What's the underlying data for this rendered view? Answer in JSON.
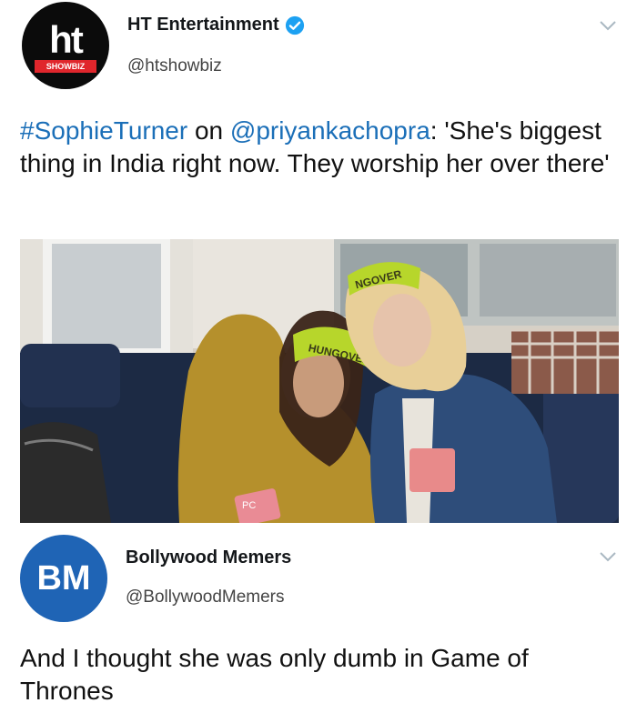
{
  "tweet1": {
    "avatar_text": "ht",
    "avatar_sub": "SHOWBIZ",
    "name": "HT Entertainment",
    "handle": "@htshowbiz",
    "text_parts": [
      "#SophieTurner",
      " on ",
      "@priyankachopra",
      ": 'She's biggest thing in India right now. They worship her over there'"
    ],
    "image": {
      "mask_text_left": "HUNGOVER",
      "mask_text_right": "NGOVER",
      "flask_text": "PC"
    }
  },
  "tweet2": {
    "avatar_text": "BM",
    "name": "Bollywood Memers",
    "handle": "@BollywoodMemers",
    "text": "And I thought she was only dumb in Game of Thrones"
  },
  "colors": {
    "link": "#1b6fb8",
    "verified": "#1da1f2",
    "ht_red": "#e0262c",
    "bm_blue": "#1f64b5"
  }
}
